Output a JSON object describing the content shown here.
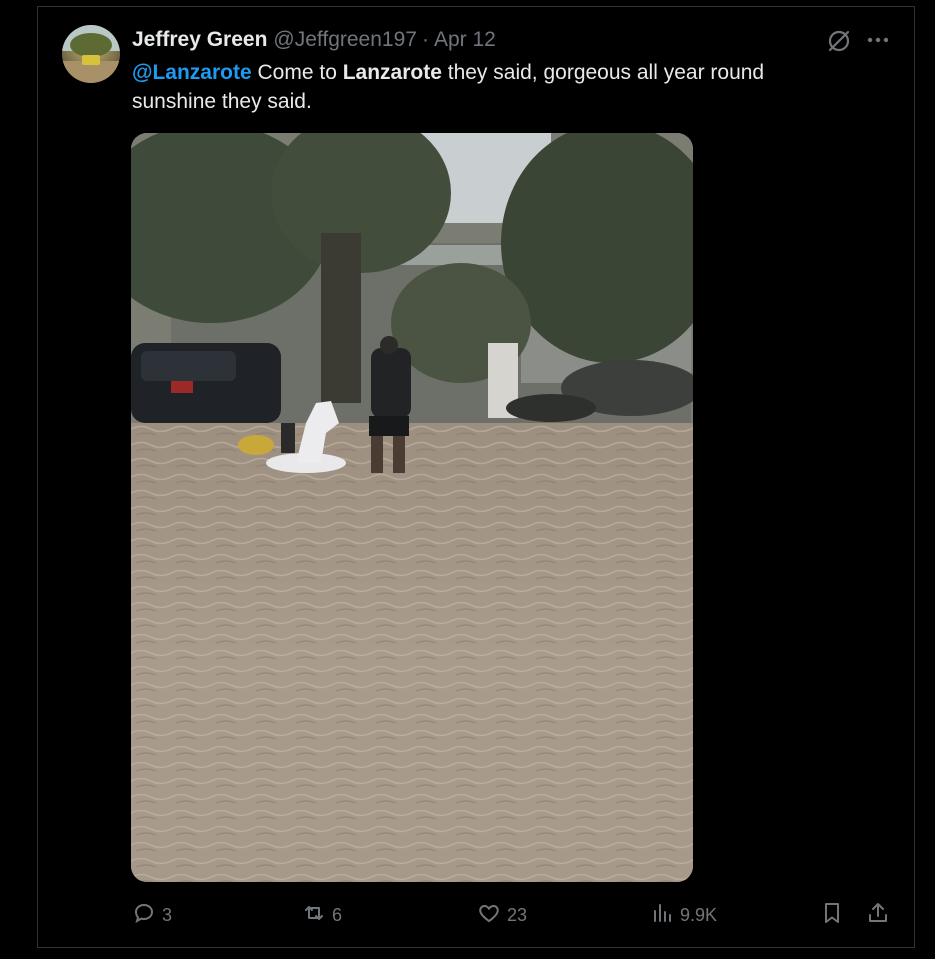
{
  "author": {
    "display_name": "Jeffrey Green",
    "handle": "@Jeffgreen197",
    "separator": "·",
    "date": "Apr 12"
  },
  "tweet": {
    "mention": "@Lanzarote",
    "text_part1": " Come to ",
    "bold_word": "Lanzarote",
    "text_part2": " they said, gorgeous all year round sunshine they said."
  },
  "icons": {
    "grok": "grok-icon",
    "more": "more-icon",
    "reply": "reply-icon",
    "repost": "repost-icon",
    "like": "heart-icon",
    "views": "views-icon",
    "bookmark": "bookmark-icon",
    "share": "share-icon"
  },
  "metrics": {
    "replies": "3",
    "reposts": "6",
    "likes": "23",
    "views": "9.9K"
  },
  "colors": {
    "background": "#000000",
    "text": "#e7e9ea",
    "muted": "#71767b",
    "link": "#1d9bf0",
    "border": "#2f3336"
  }
}
